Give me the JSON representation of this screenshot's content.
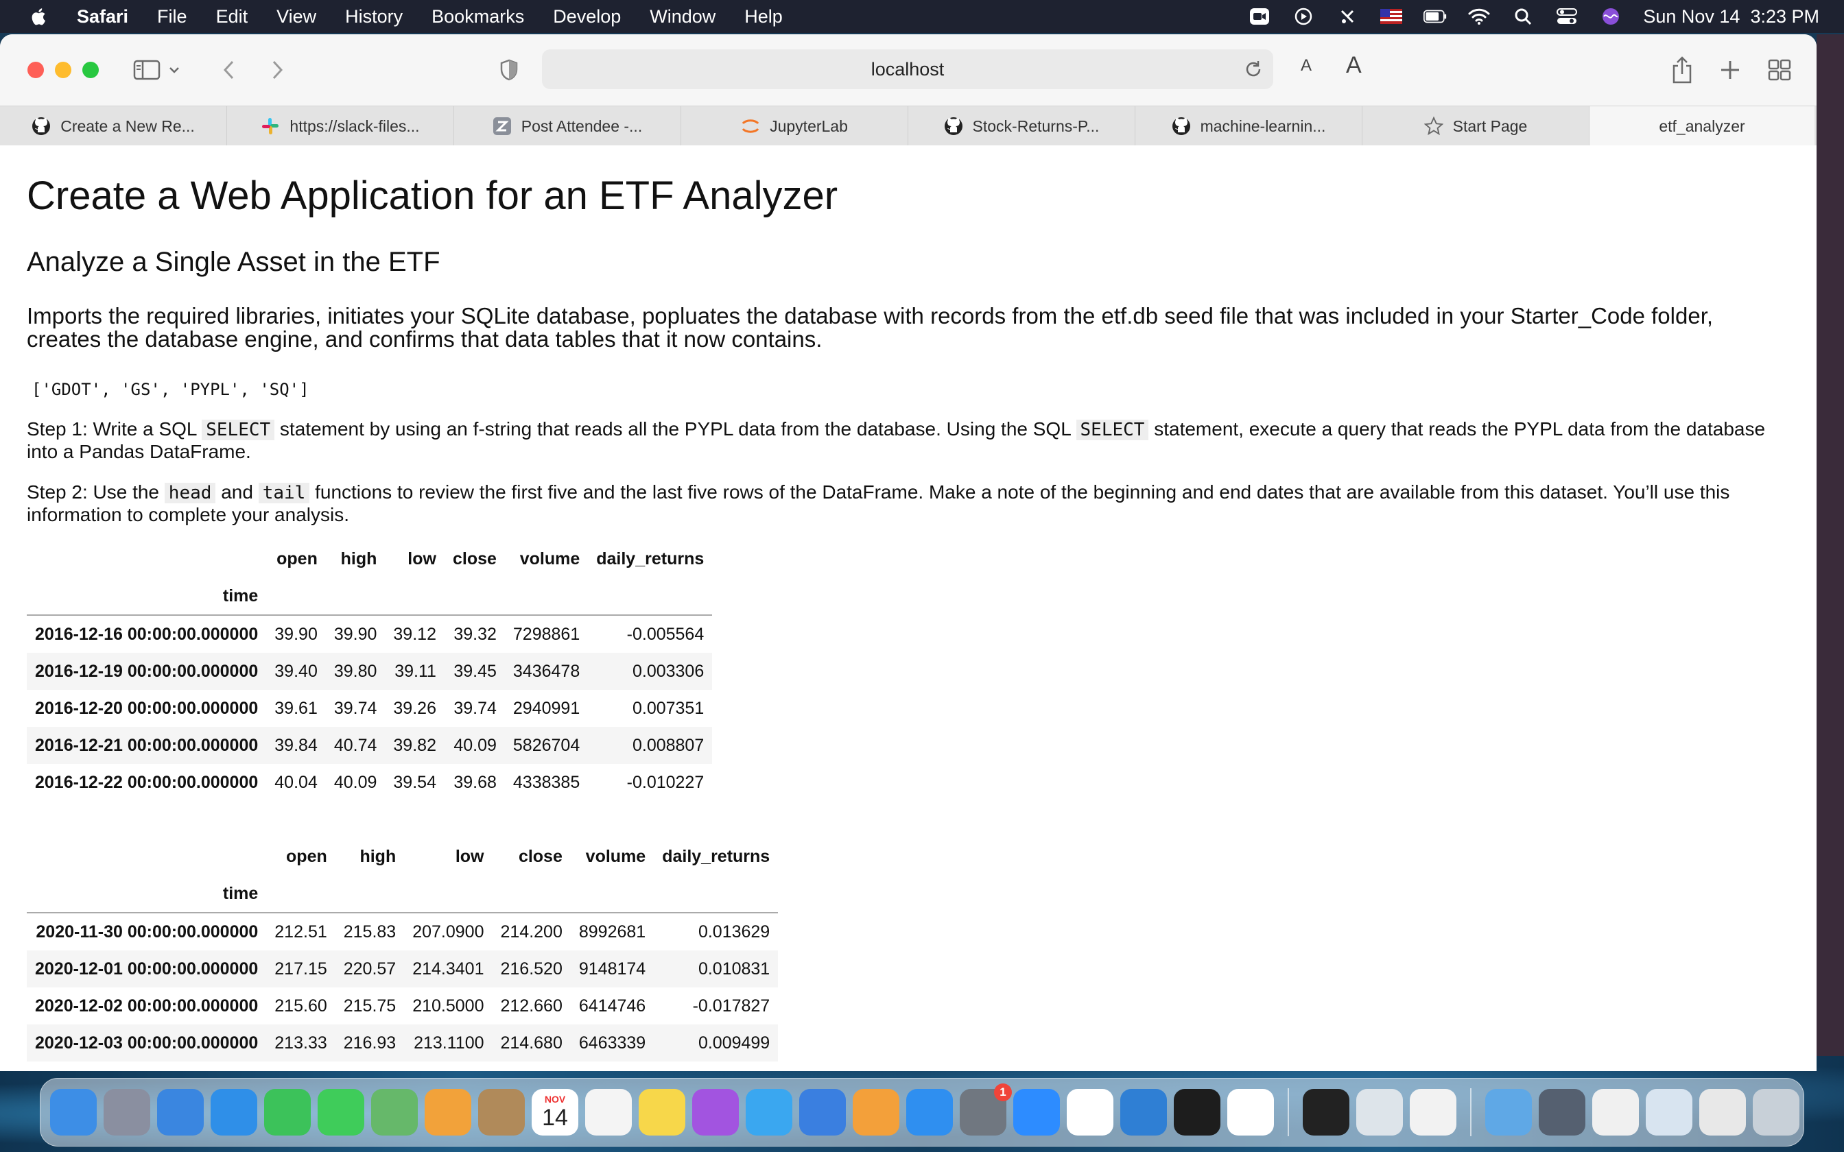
{
  "menubar": {
    "items": [
      "Safari",
      "File",
      "Edit",
      "View",
      "History",
      "Bookmarks",
      "Develop",
      "Window",
      "Help"
    ],
    "clock": "Sun Nov 14  3:23 PM"
  },
  "toolbar": {
    "url": "localhost",
    "text_smaller": "A",
    "text_larger": "A"
  },
  "tabs": [
    {
      "label": "Create a New Re...",
      "icon": "github-icon"
    },
    {
      "label": "https://slack-files...",
      "icon": "slack-icon"
    },
    {
      "label": "Post Attendee -...",
      "icon": "zoom-z-icon"
    },
    {
      "label": "JupyterLab",
      "icon": "jupyter-icon"
    },
    {
      "label": "Stock-Returns-P...",
      "icon": "github-icon"
    },
    {
      "label": "machine-learnin...",
      "icon": "github-icon"
    },
    {
      "label": "Start Page",
      "icon": "star-icon"
    },
    {
      "label": "etf_analyzer",
      "icon": ""
    }
  ],
  "content": {
    "title": "Create a Web Application for an ETF Analyzer",
    "subtitle": "Analyze a Single Asset in the ETF",
    "intro": "Imports the required libraries, initiates your SQLite database, popluates the database with records from the etf.db seed file that was included in your Starter_Code folder, creates the database engine, and confirms that data tables that it now contains.",
    "tables_output": "['GDOT', 'GS', 'PYPL', 'SQ']",
    "step1": {
      "a": "Step 1: Write a SQL ",
      "code1": "SELECT",
      "b": " statement by using an f-string that reads all the PYPL data from the database. Using the SQL ",
      "code2": "SELECT",
      "c": " statement, execute a query that reads the PYPL data from the database into a Pandas DataFrame."
    },
    "step2": {
      "a": "Step 2: Use the ",
      "code1": "head",
      "b": " and ",
      "code2": "tail",
      "c": " functions to review the first five and the last five rows of the DataFrame. Make a note of the beginning and end dates that are available from this dataset. You’ll use this information to complete your analysis."
    }
  },
  "head_table": {
    "columns": [
      "open",
      "high",
      "low",
      "close",
      "volume",
      "daily_returns"
    ],
    "index_name": "time",
    "rows": [
      {
        "time": "2016-12-16 00:00:00.000000",
        "open": "39.90",
        "high": "39.90",
        "low": "39.12",
        "close": "39.32",
        "volume": "7298861",
        "daily_returns": "-0.005564"
      },
      {
        "time": "2016-12-19 00:00:00.000000",
        "open": "39.40",
        "high": "39.80",
        "low": "39.11",
        "close": "39.45",
        "volume": "3436478",
        "daily_returns": "0.003306"
      },
      {
        "time": "2016-12-20 00:00:00.000000",
        "open": "39.61",
        "high": "39.74",
        "low": "39.26",
        "close": "39.74",
        "volume": "2940991",
        "daily_returns": "0.007351"
      },
      {
        "time": "2016-12-21 00:00:00.000000",
        "open": "39.84",
        "high": "40.74",
        "low": "39.82",
        "close": "40.09",
        "volume": "5826704",
        "daily_returns": "0.008807"
      },
      {
        "time": "2016-12-22 00:00:00.000000",
        "open": "40.04",
        "high": "40.09",
        "low": "39.54",
        "close": "39.68",
        "volume": "4338385",
        "daily_returns": "-0.010227"
      }
    ]
  },
  "tail_table": {
    "columns": [
      "open",
      "high",
      "low",
      "close",
      "volume",
      "daily_returns"
    ],
    "index_name": "time",
    "rows": [
      {
        "time": "2020-11-30 00:00:00.000000",
        "open": "212.51",
        "high": "215.83",
        "low": "207.0900",
        "close": "214.200",
        "volume": "8992681",
        "daily_returns": "0.013629"
      },
      {
        "time": "2020-12-01 00:00:00.000000",
        "open": "217.15",
        "high": "220.57",
        "low": "214.3401",
        "close": "216.520",
        "volume": "9148174",
        "daily_returns": "0.010831"
      },
      {
        "time": "2020-12-02 00:00:00.000000",
        "open": "215.60",
        "high": "215.75",
        "low": "210.5000",
        "close": "212.660",
        "volume": "6414746",
        "daily_returns": "-0.017827"
      },
      {
        "time": "2020-12-03 00:00:00.000000",
        "open": "213.33",
        "high": "216.93",
        "low": "213.1100",
        "close": "214.680",
        "volume": "6463339",
        "daily_returns": "0.009499"
      }
    ]
  },
  "dock": {
    "apps": [
      {
        "name": "finder-icon",
        "color": "#3d8ee6"
      },
      {
        "name": "launchpad-icon",
        "color": "#8a8fa0"
      },
      {
        "name": "mail-icon",
        "color": "#3a86e0"
      },
      {
        "name": "safari-icon",
        "color": "#2f8fe8"
      },
      {
        "name": "facetime-icon",
        "color": "#3cc25a"
      },
      {
        "name": "messages-icon",
        "color": "#3fcc5a"
      },
      {
        "name": "maps-icon",
        "color": "#66b86a"
      },
      {
        "name": "photos-icon",
        "color": "#f2a23a"
      },
      {
        "name": "contacts-icon",
        "color": "#b08a5a"
      },
      {
        "name": "calendar-icon",
        "color": "#ffffff"
      },
      {
        "name": "reminders-icon",
        "color": "#f4f4f4"
      },
      {
        "name": "notes-icon",
        "color": "#f7d74a"
      },
      {
        "name": "podcasts-icon",
        "color": "#a254e0"
      },
      {
        "name": "numbers-icon",
        "color": "#3aa7f0"
      },
      {
        "name": "keynote-icon",
        "color": "#3a7fe0"
      },
      {
        "name": "pages-icon",
        "color": "#f3a03a"
      },
      {
        "name": "app-store-icon",
        "color": "#2f8ff0"
      },
      {
        "name": "system-preferences-icon",
        "color": "#707780"
      },
      {
        "name": "zoom-icon",
        "color": "#2d8cff"
      },
      {
        "name": "slack-icon",
        "color": "#ffffff"
      },
      {
        "name": "vscode-icon",
        "color": "#2f7fd4"
      },
      {
        "name": "spotify-icon",
        "color": "#1d1d1d"
      },
      {
        "name": "chrome-icon",
        "color": "#ffffff"
      },
      {
        "name": "terminal-icon",
        "color": "#222222"
      },
      {
        "name": "preview-icon",
        "color": "#dde4ea"
      },
      {
        "name": "textedit-icon",
        "color": "#f2f2f2"
      },
      {
        "name": "downloads-folder-icon",
        "color": "#5fa8e6"
      },
      {
        "name": "recent-window-1",
        "color": "#556070"
      },
      {
        "name": "recent-window-2",
        "color": "#f0f0f0"
      },
      {
        "name": "recent-window-3",
        "color": "#d8e4f0"
      },
      {
        "name": "recent-window-4",
        "color": "#e8e8e8"
      },
      {
        "name": "trash-icon",
        "color": "#c8d0d8"
      }
    ],
    "calendar_month": "NOV",
    "calendar_day": "14",
    "system_prefs_badge": "1"
  }
}
